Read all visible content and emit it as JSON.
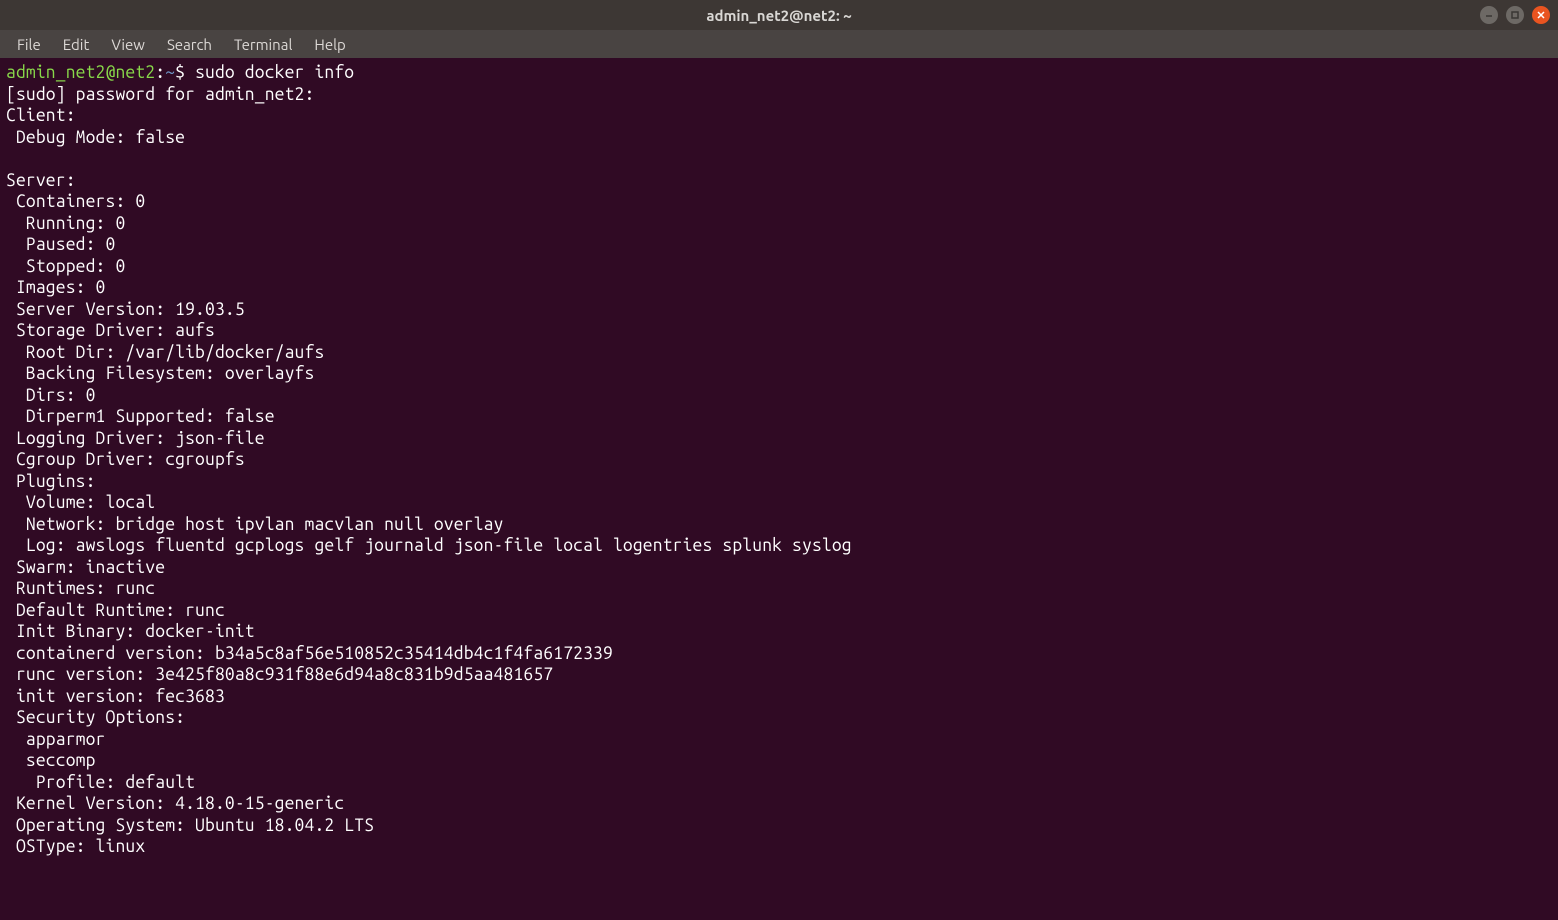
{
  "titlebar": {
    "title": "admin_net2@net2: ~"
  },
  "menubar": {
    "items": [
      "File",
      "Edit",
      "View",
      "Search",
      "Terminal",
      "Help"
    ]
  },
  "prompt": {
    "userhost": "admin_net2@net2",
    "sep": ":",
    "path": "~",
    "sigil": "$",
    "command": "sudo docker info"
  },
  "lines": [
    "[sudo] password for admin_net2: ",
    "Client:",
    " Debug Mode: false",
    "",
    "Server:",
    " Containers: 0",
    "  Running: 0",
    "  Paused: 0",
    "  Stopped: 0",
    " Images: 0",
    " Server Version: 19.03.5",
    " Storage Driver: aufs",
    "  Root Dir: /var/lib/docker/aufs",
    "  Backing Filesystem: overlayfs",
    "  Dirs: 0",
    "  Dirperm1 Supported: false",
    " Logging Driver: json-file",
    " Cgroup Driver: cgroupfs",
    " Plugins:",
    "  Volume: local",
    "  Network: bridge host ipvlan macvlan null overlay",
    "  Log: awslogs fluentd gcplogs gelf journald json-file local logentries splunk syslog",
    " Swarm: inactive",
    " Runtimes: runc",
    " Default Runtime: runc",
    " Init Binary: docker-init",
    " containerd version: b34a5c8af56e510852c35414db4c1f4fa6172339",
    " runc version: 3e425f80a8c931f88e6d94a8c831b9d5aa481657",
    " init version: fec3683",
    " Security Options:",
    "  apparmor",
    "  seccomp",
    "   Profile: default",
    " Kernel Version: 4.18.0-15-generic",
    " Operating System: Ubuntu 18.04.2 LTS",
    " OSType: linux"
  ]
}
